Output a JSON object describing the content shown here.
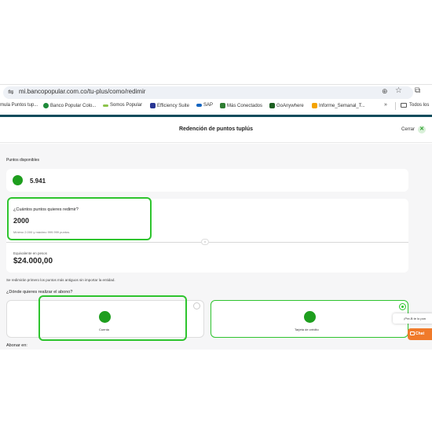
{
  "browser": {
    "url": "mi.bancopopular.com.co/tu-plus/como/redimir",
    "bookmarks": [
      {
        "label": "mula Puntos tup...",
        "color": ""
      },
      {
        "label": "Banco Popular Colo...",
        "color": "#1e8a3a"
      },
      {
        "label": "Somos Popular",
        "color": "#8bc34a"
      },
      {
        "label": "Efficiency Suite",
        "color": "#283593"
      },
      {
        "label": "SAP",
        "color": "#1565c0"
      },
      {
        "label": "Más Conectados",
        "color": "#2e7d32"
      },
      {
        "label": "GoAnywhere",
        "color": "#1b5e20"
      },
      {
        "label": "Informe_Semanal_T...",
        "color": "#f4a300"
      }
    ],
    "more": "»",
    "all_bookmarks": "Todos los"
  },
  "header": {
    "title": "Redención de puntos tuplús",
    "close_label": "Cerrar"
  },
  "points": {
    "section_label": "Puntos disponibles",
    "value": "5.941"
  },
  "redeem": {
    "question": "¿Cuántos puntos quieres redimir?",
    "value": "2000",
    "help": "Mínimo 2.000 y máximo 999.999 puntos.",
    "separator_badge": "=",
    "equivalent_label": "Equivalente en pesos",
    "equivalent_value": "$24.000,00"
  },
  "notice": "Se redimirán primero los puntos más antiguos sin importar la entidad.",
  "deposit": {
    "question": "¿Dónde quieres realizar el abono?",
    "options": [
      {
        "label": "Cuenta",
        "selected": false
      },
      {
        "label": "Tarjeta de crédito",
        "selected": true
      }
    ],
    "abonar_label": "Abonar en:"
  },
  "chat": {
    "tooltip": "¡Pre-B te lo pon",
    "button_label": "Chat"
  },
  "colors": {
    "accent_green": "#1e9e1e",
    "highlight_green": "#2ec42e",
    "header_teal": "#0f4c5c",
    "chat_orange": "#f07a2a"
  }
}
